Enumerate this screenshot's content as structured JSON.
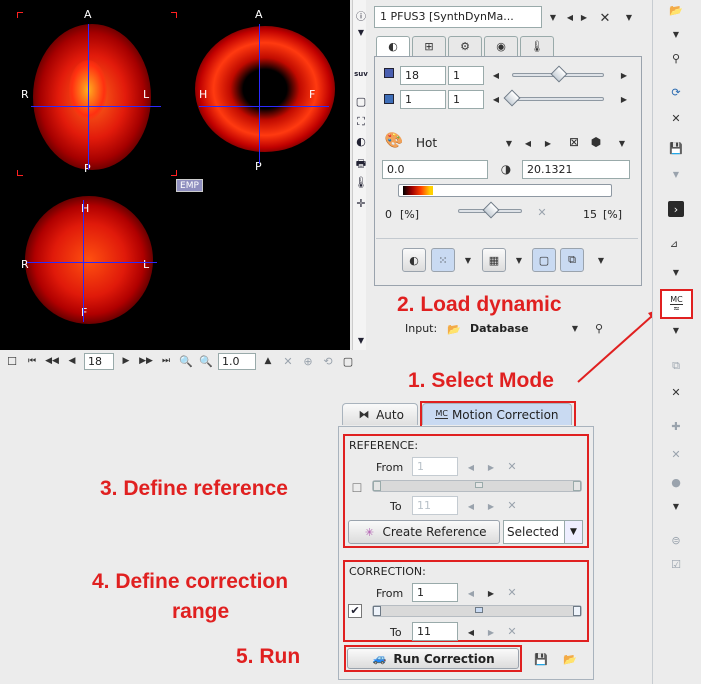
{
  "viewer": {
    "orient": {
      "t1": {
        "top": "A",
        "bottom": "P",
        "left": "R",
        "right": "L"
      },
      "t2": {
        "top": "A",
        "bottom": "P",
        "left": "H",
        "right": "F"
      },
      "t3": {
        "top": "H",
        "bottom": "F",
        "left": "R",
        "right": "L"
      }
    },
    "emp_label": "EMP",
    "toolbar": {
      "frame": "18",
      "zoom": "1.0"
    }
  },
  "side_tools": [
    "i",
    "suv",
    "img",
    "cam",
    "lock",
    "move"
  ],
  "control": {
    "dataset": "1 PFUS3 [SynthDynMa...",
    "slice": {
      "a": "18",
      "b": "1"
    },
    "frame": {
      "a": "1",
      "b": "1"
    },
    "colormap": "Hot",
    "min": "0.0",
    "max": "20.1321",
    "range_low": "0",
    "range_unit": "[%]",
    "range_high": "15",
    "range_unit2": "[%]"
  },
  "input": {
    "label": "Input:",
    "source": "Database"
  },
  "tabs": {
    "auto": "Auto",
    "mc": "Motion Correction",
    "mc_icon": "MC"
  },
  "reference": {
    "title": "REFERENCE:",
    "from_label": "From",
    "from_value": "1",
    "to_label": "To",
    "to_value": "11",
    "create_btn": "Create Reference",
    "mode": "Selected"
  },
  "correction": {
    "title": "CORRECTION:",
    "from_label": "From",
    "from_value": "1",
    "to_label": "To",
    "to_value": "11",
    "checked": "✔"
  },
  "run": {
    "label": "Run Correction"
  },
  "annotations": {
    "a1": "1. Select Mode",
    "a2": "2. Load dynamic",
    "a3": "3. Define reference",
    "a4a": "4. Define correction",
    "a4b": "range",
    "a5": "5. Run"
  },
  "right_toolbar": {
    "mc_label": "MC"
  },
  "colors": {
    "annotation": "#e02020",
    "crosshair": "#2a2aff",
    "tab_active": "#c9daf2"
  }
}
